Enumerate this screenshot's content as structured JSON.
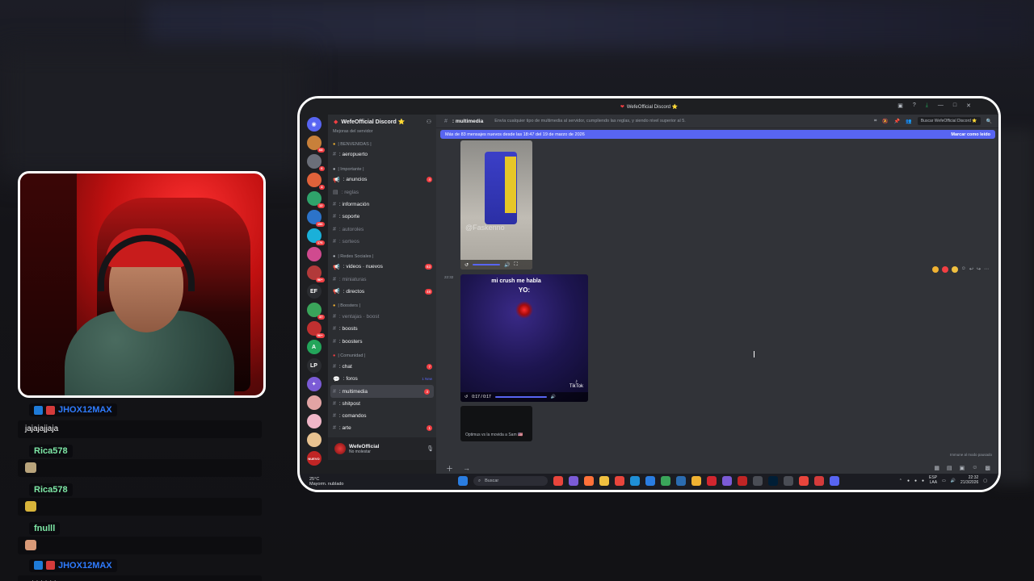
{
  "chat": {
    "messages": [
      {
        "user": "JHOX12MAX",
        "text": "jajajajjaja",
        "name_color": "#2f7cff"
      },
      {
        "user": "Rica578",
        "text": "",
        "name_color": "#7ee8a6"
      },
      {
        "user": "Rica578",
        "text": "",
        "name_color": "#7ee8a6"
      },
      {
        "user": "fnulll",
        "text": "",
        "name_color": "#7ee8a6"
      },
      {
        "user": "JHOX12MAX",
        "text": "xdddddd",
        "name_color": "#2f7cff"
      }
    ]
  },
  "discord": {
    "window_title": "WefeOfficial Discord ⭐",
    "server_name": "WefeOfficial Discord ⭐",
    "server_sub": "Mejoras del servidor",
    "guild_labels": {
      "ef": "EF",
      "lp": "LP",
      "nuevo": "NUEVO"
    },
    "guild_badges": [
      "68",
      "6",
      "4",
      "12",
      "156",
      "176",
      "96+",
      "37",
      "96+"
    ],
    "categories": {
      "bienvenidas": "| BENVENIDAS |",
      "importante": "| Importante |",
      "redes": "| Redes Sociales |",
      "boosters": "| Boosters |",
      "comunidad": "| Comunidad |"
    },
    "channels": {
      "aeropuerto": ": aeropuerto",
      "anuncios": ": anuncios",
      "reglas": ": reglas",
      "informacion": ": información",
      "soporte": ": soporte",
      "autoroles": ": autoroles",
      "sorteos": ": sorteos",
      "videos": ": videos · nuevos",
      "miniaturas": ": miniaturas",
      "directos": ": directos",
      "ventajas": ": ventajas · boost",
      "boosts": ": boosts",
      "boosters": ": boosters",
      "chat": ": chat",
      "foros": ": foros",
      "multimedia": ": multimedia",
      "shitpost": ": shitpost",
      "comandos": ": comandos",
      "arte": ": arte"
    },
    "channel_badges": {
      "anuncios": "4",
      "videos": "83",
      "directos": "48",
      "chat": "7",
      "multimedia": "3",
      "arte": "1"
    },
    "foros_new": "1 New",
    "user": {
      "name": "WefeOfficial",
      "status": "No molestar"
    },
    "header": {
      "channel": ": multimedia",
      "topic": "Envía cualquier tipo de multimedia al servidor, cumpliendo las reglas, y siendo nivel superior al 5.",
      "search_placeholder": "Buscar WefeOfficial Discord ⭐"
    },
    "newbar": {
      "text": "Más de 83 mensajes nuevos desde las 18:47 del 19 de marzo de 2026",
      "action": "Marcar como leído"
    },
    "messages": {
      "watermark": "@Faskenno",
      "time": "22:32",
      "caption1": "mi crush me habla",
      "caption2": "YO:",
      "video_time": "0:17 / 0:17",
      "tiktok": "TikTok",
      "preview_text": "Optimus vs la movida a Sam 🇺🇸",
      "paused": "Immune al modo pausado"
    }
  },
  "taskbar": {
    "temp": "25°C",
    "weather": "Mayorm. nublado",
    "search": "Buscar",
    "lang": "ESP",
    "lang2": "LAA",
    "time": "22:32",
    "date": "21/3/2026"
  }
}
